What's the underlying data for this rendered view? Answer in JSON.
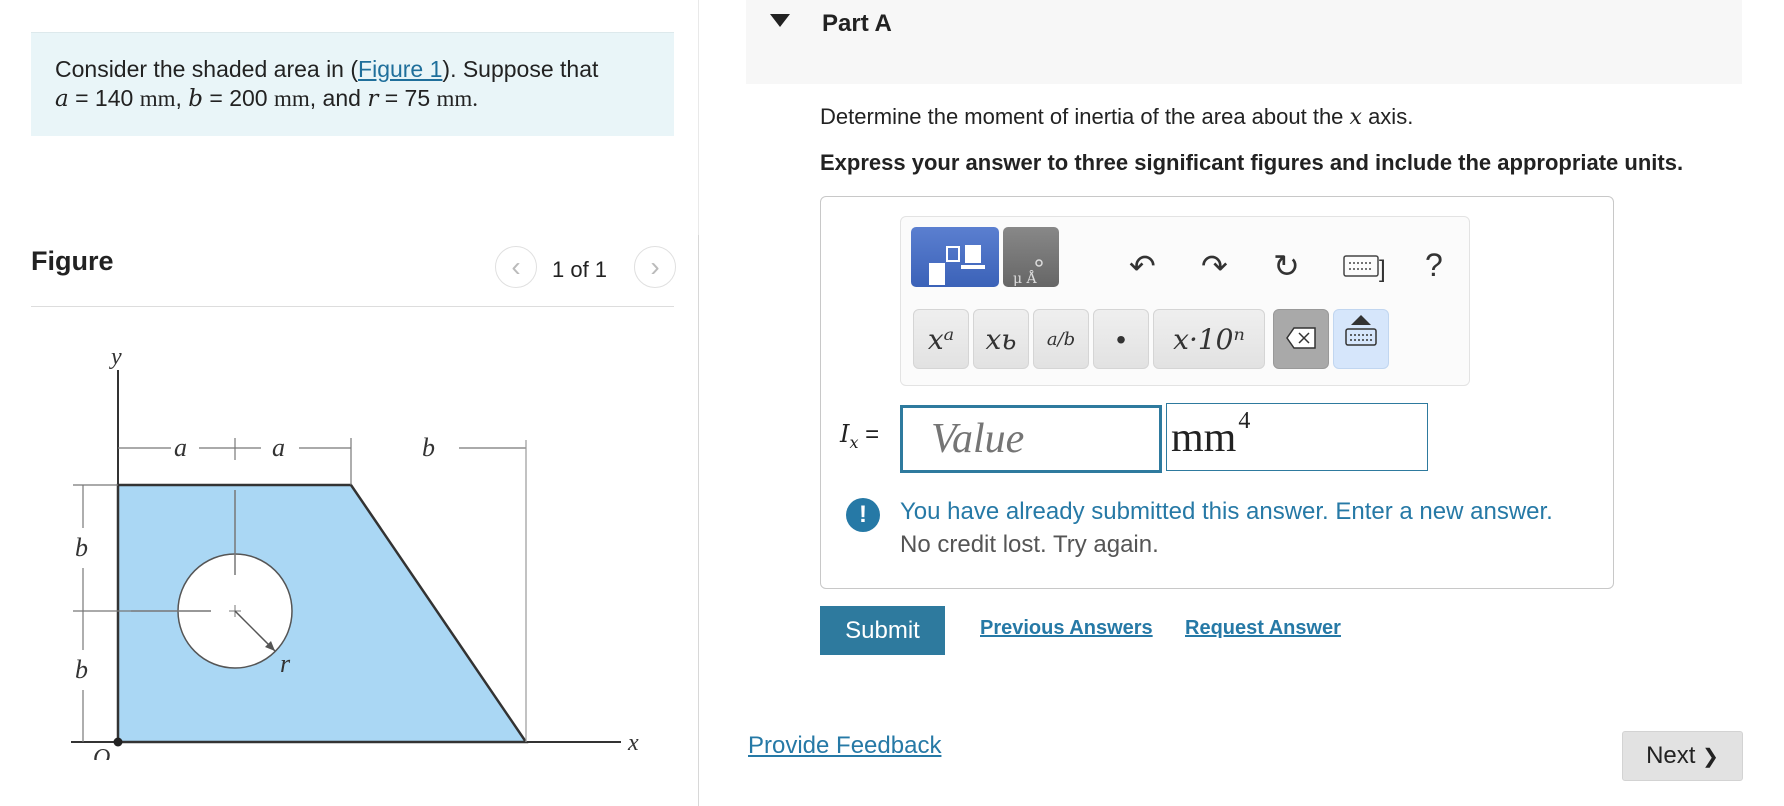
{
  "problem": {
    "text_prefix": "Consider the shaded area in (",
    "figure_link": "Figure 1",
    "text_suffix": "). Suppose that",
    "a_sym": "a",
    "a_val": " = 140 ",
    "a_unit": "mm",
    "b_sym": "b",
    "b_val": " = 200 ",
    "b_unit": "mm",
    "and": ", and ",
    "r_sym": "r",
    "r_val": " = 75 ",
    "r_unit": "mm."
  },
  "figure": {
    "title": "Figure",
    "pager": "1 of 1",
    "prev_icon": "‹",
    "next_icon": "›",
    "labels": {
      "y": "y",
      "x": "x",
      "o": "O",
      "a1": "a",
      "a2": "a",
      "b_top": "b",
      "b_left1": "b",
      "b_left2": "b",
      "r": "r"
    }
  },
  "part": {
    "title": "Part A"
  },
  "question": {
    "text_prefix": "Determine the moment of inertia of the area about the ",
    "axis": "x",
    "text_suffix": " axis.",
    "instruction": "Express your answer to three significant figures and include the appropriate units."
  },
  "toolbar": {
    "keys": {
      "power": "xᵃ",
      "subscript": "xь",
      "fraction": "a/b",
      "dot": "•",
      "sci": "x·10ⁿ",
      "help": "?",
      "keyboard_suffix": "]"
    }
  },
  "answer": {
    "label_sym": "I",
    "label_sub": "x",
    "label_eq": " =",
    "placeholder": "Value",
    "units": "mm",
    "units_exp": "4"
  },
  "alert": {
    "icon": "!",
    "message": "You have already submitted this answer. Enter a new answer.",
    "sub": "No credit lost. Try again."
  },
  "actions": {
    "submit": "Submit",
    "previous": "Previous Answers",
    "request": "Request Answer",
    "feedback": "Provide Feedback",
    "next": "Next",
    "next_icon": "❯"
  },
  "colors": {
    "shape_fill": "#aad7f4",
    "accent": "#2e7a9e",
    "link": "#2679a6",
    "problem_bg": "#e9f5f8"
  }
}
